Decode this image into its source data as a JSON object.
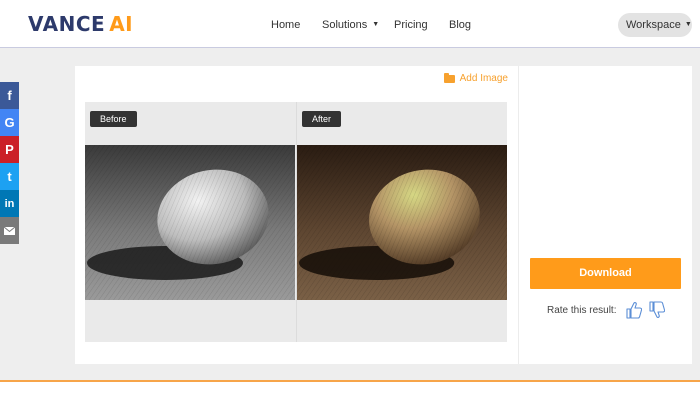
{
  "header": {
    "logo_main": "VANCE",
    "logo_accent": "AI",
    "nav": {
      "home": "Home",
      "solutions": "Solutions",
      "pricing": "Pricing",
      "blog": "Blog"
    },
    "workspace": "Workspace"
  },
  "social": {
    "facebook": "f",
    "google": "G",
    "pinterest": "P",
    "twitter": "t",
    "linkedin": "in"
  },
  "editor": {
    "add_image": "Add Image",
    "before_label": "Before",
    "after_label": "After"
  },
  "panel": {
    "download": "Download",
    "rate_label": "Rate this result:"
  },
  "icons": [
    "facebook-icon",
    "google-icon",
    "pinterest-icon",
    "twitter-icon",
    "linkedin-icon",
    "mail-icon",
    "folder-icon",
    "thumbs-up-icon",
    "thumbs-down-icon",
    "chevron-down-icon"
  ],
  "colors": {
    "brand_dark": "#2d3a6b",
    "brand_orange": "#ff9b1a"
  }
}
